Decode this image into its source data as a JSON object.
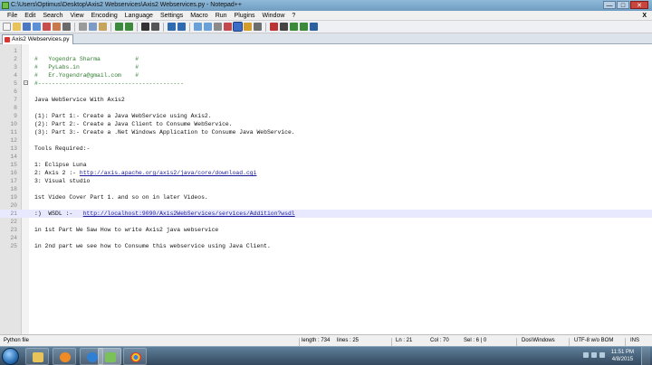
{
  "window": {
    "title": "C:\\Users\\Optimus\\Desktop\\Axis2 Webservices\\Axis2 Webservices.py - Notepad++"
  },
  "menu": [
    "File",
    "Edit",
    "Search",
    "View",
    "Encoding",
    "Language",
    "Settings",
    "Macro",
    "Run",
    "Plugins",
    "Window",
    "?"
  ],
  "menu_close": "X",
  "tab": {
    "label": "Axis2 Webservices.py"
  },
  "lines": [
    {
      "n": "1",
      "text": ""
    },
    {
      "n": "2",
      "text": "#   Yogendra Sharma          #"
    },
    {
      "n": "3",
      "text": "#   PyLabs.in                #"
    },
    {
      "n": "4",
      "text": "#   Er.Yogendra@gmail.com    #"
    },
    {
      "n": "5",
      "text": "#------------------------------------------"
    },
    {
      "n": "6",
      "text": ""
    },
    {
      "n": "7",
      "text": "Java WebService With Axis2"
    },
    {
      "n": "8",
      "text": ""
    },
    {
      "n": "9",
      "text": "(1): Part 1:- Create a Java WebService using Axis2."
    },
    {
      "n": "10",
      "text": "(2): Part 2:- Create a Java Client to Consume WebService."
    },
    {
      "n": "11",
      "text": "(3): Part 3:- Create a .Net Windows Application to Consume Java WebService."
    },
    {
      "n": "12",
      "text": ""
    },
    {
      "n": "13",
      "text": "Tools Required:-"
    },
    {
      "n": "14",
      "text": ""
    },
    {
      "n": "15",
      "text": "1: Eclipse Luna"
    },
    {
      "n": "16",
      "text": "2: Axis 2 :- ",
      "url": "http://axis.apache.org/axis2/java/core/download.cgi"
    },
    {
      "n": "17",
      "text": "3: Visual studio"
    },
    {
      "n": "18",
      "text": ""
    },
    {
      "n": "19",
      "text": "1st Video Cover Part 1. and so on in later Videos."
    },
    {
      "n": "20",
      "text": ""
    },
    {
      "n": "21",
      "text": ":)  WSDL :-   ",
      "url": "http://localhost:9090/Axis2WebServices/services/Addition?wsdl",
      "current": true
    },
    {
      "n": "22",
      "text": ""
    },
    {
      "n": "23",
      "text": "in 1st Part We Saw How to write Axis2 java webservice"
    },
    {
      "n": "24",
      "text": ""
    },
    {
      "n": "25",
      "text": "in 2nd part we see how to Consume this webservice using Java Client."
    }
  ],
  "status": {
    "filetype": "Python file",
    "length": "length : 734",
    "lines": "lines : 25",
    "ln": "Ln : 21",
    "col": "Col : 70",
    "sel": "Sel : 6 | 0",
    "eol": "Dos\\Windows",
    "encoding": "UTF-8 w/o BOM",
    "mode": "INS"
  },
  "clock": {
    "time": "11:51 PM",
    "date": "4/8/2015"
  },
  "colors": {
    "current_line": "#e8e8ff",
    "comment": "#2f7d2f",
    "url": "#1a1a9a"
  }
}
